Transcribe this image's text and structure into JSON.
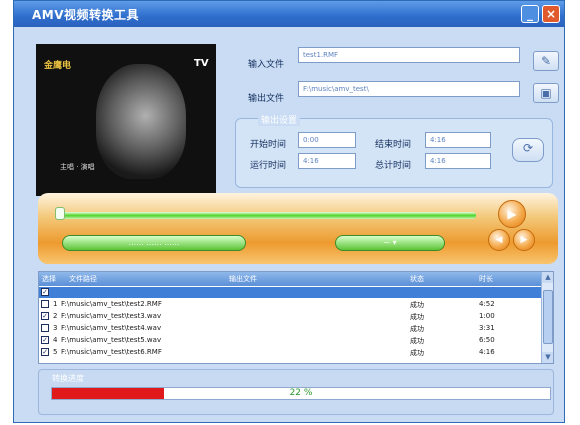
{
  "window": {
    "title": "AMV视频转换工具",
    "minimize": "_",
    "close": "×"
  },
  "preview": {
    "logo": "金鹰电",
    "corner": "TV",
    "caption": "主唱 · 演唱"
  },
  "files": {
    "input_label": "输入文件",
    "input_value": "test1.RMF",
    "output_label": "输出文件",
    "output_value": "F:\\music\\amv_test\\"
  },
  "output_options": {
    "group_title": "输出设置",
    "start_label": "开始时间",
    "start_value": "0:00",
    "end_label": "结束时间",
    "end_value": "4:16",
    "duration_label": "运行时间",
    "duration_value": "4:16",
    "total_label": "总计时间",
    "total_value": "4:16"
  },
  "player": {
    "buttons": [
      "播放",
      "暂停"
    ],
    "pill_left": "...... ...... ......",
    "pill_right": "~     ▾",
    "progress_percent": 0
  },
  "list": {
    "headers": [
      "选择",
      "文件路径",
      "输出文件",
      "状态",
      "时长"
    ],
    "rows": [
      {
        "checked": "✓",
        "num": "",
        "path": "",
        "out": "",
        "status": "",
        "time": "",
        "selected": true
      },
      {
        "checked": "",
        "num": "1",
        "path": "F:\\music\\amv_test\\test2.RMF",
        "out": "",
        "status": "成功",
        "time": "4:52",
        "selected": false
      },
      {
        "checked": "✓",
        "num": "2",
        "path": "F:\\music\\amv_test\\test3.wav",
        "out": "",
        "status": "成功",
        "time": "1:00",
        "selected": false
      },
      {
        "checked": "",
        "num": "3",
        "path": "F:\\music\\amv_test\\test4.wav",
        "out": "",
        "status": "成功",
        "time": "3:31",
        "selected": false
      },
      {
        "checked": "✓",
        "num": "4",
        "path": "F:\\music\\amv_test\\test5.wav",
        "out": "",
        "status": "成功",
        "time": "6:50",
        "selected": false
      },
      {
        "checked": "✓",
        "num": "5",
        "path": "F:\\music\\amv_test\\test6.RMF",
        "out": "",
        "status": "成功",
        "time": "4:16",
        "selected": false
      }
    ]
  },
  "progress": {
    "label": "转换进度",
    "percent_text": "22 %",
    "value": 0.225
  },
  "colors": {
    "accent": "#2f6dcc",
    "progress": "#e01a1a",
    "track": "#52d22a"
  }
}
